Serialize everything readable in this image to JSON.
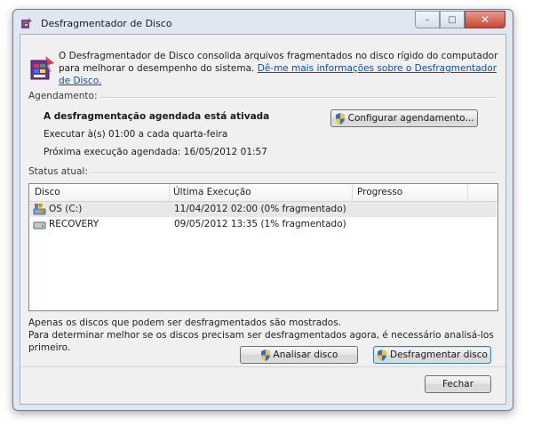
{
  "window": {
    "title": "Desfragmentador de Disco",
    "controls": {
      "minimize": "–",
      "maximize": "□",
      "close": "✕"
    }
  },
  "intro": {
    "text": "O Desfragmentador de Disco consolida arquivos fragmentados no disco rígido do computador para melhorar o desempenho do sistema.",
    "link": "Dê-me mais informações sobre o Desfragmentador de Disco."
  },
  "schedule": {
    "group_label": "Agendamento:",
    "status": "A desfragmentação agendada está ativada",
    "run_at": "Executar à(s) 01:00 a cada quarta-feira",
    "next_run": "Próxima execução agendada: 16/05/2012 01:57",
    "configure_button": "Configurar agendamento..."
  },
  "status": {
    "group_label": "Status atual:",
    "columns": [
      "Disco",
      "Última Execução",
      "Progresso"
    ],
    "rows": [
      {
        "disk": "OS (C:)",
        "last_run": "11/04/2012 02:00 (0% fragmentado)",
        "progress": "",
        "icon": "system-drive-icon"
      },
      {
        "disk": "RECOVERY",
        "last_run": "09/05/2012 13:35 (1% fragmentado)",
        "progress": "",
        "icon": "drive-icon"
      }
    ]
  },
  "notes": {
    "line1": "Apenas os discos que podem ser desfragmentados são mostrados.",
    "line2": "Para determinar melhor se os discos precisam ser desfragmentados agora, é necessário analisá-los primeiro."
  },
  "actions": {
    "analyze": "Analisar disco",
    "defragment": "Desfragmentar disco",
    "close": "Fechar"
  }
}
